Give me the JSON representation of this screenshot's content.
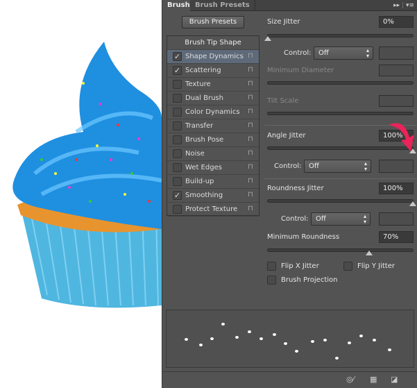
{
  "panel": {
    "tabs": [
      {
        "label": "Brush",
        "active": true
      },
      {
        "label": "Brush Presets",
        "active": false
      }
    ],
    "menu_icons": [
      "expand-icon",
      "panel-menu-icon"
    ],
    "brush_presets_button": "Brush Presets",
    "list": {
      "header": "Brush Tip Shape",
      "items": [
        {
          "label": "Shape Dynamics",
          "checked": true,
          "selected": true
        },
        {
          "label": "Scattering",
          "checked": true
        },
        {
          "label": "Texture",
          "checked": false
        },
        {
          "label": "Dual Brush",
          "checked": false
        },
        {
          "label": "Color Dynamics",
          "checked": false
        },
        {
          "label": "Transfer",
          "checked": false
        },
        {
          "label": "Brush Pose",
          "checked": false
        },
        {
          "label": "Noise",
          "checked": false
        },
        {
          "label": "Wet Edges",
          "checked": false
        },
        {
          "label": "Build-up",
          "checked": false
        },
        {
          "label": "Smoothing",
          "checked": true
        },
        {
          "label": "Protect Texture",
          "checked": false
        }
      ]
    },
    "settings": {
      "size_jitter": {
        "label": "Size Jitter",
        "value": "0%",
        "percent": 0
      },
      "control1": {
        "label": "Control:",
        "value": "Off"
      },
      "minimum_diameter": {
        "label": "Minimum Diameter"
      },
      "tilt_scale": {
        "label": "Tilt Scale"
      },
      "angle_jitter": {
        "label": "Angle Jitter",
        "value": "100%",
        "percent": 100
      },
      "control2": {
        "label": "Control:",
        "value": "Off"
      },
      "roundness_jitter": {
        "label": "Roundness Jitter",
        "value": "100%",
        "percent": 100
      },
      "control3": {
        "label": "Control:",
        "value": "Off"
      },
      "minimum_roundness": {
        "label": "Minimum Roundness",
        "value": "70%",
        "percent": 70
      },
      "flip_x": {
        "label": "Flip X Jitter",
        "checked": false
      },
      "flip_y": {
        "label": "Flip Y Jitter",
        "checked": false
      },
      "brush_projection": {
        "label": "Brush Projection",
        "checked": false
      }
    },
    "footer_icons": [
      "toggle-live-tip-icon",
      "brush-grid-icon",
      "new-brush-icon"
    ],
    "annotation_color": "#e8245a"
  }
}
